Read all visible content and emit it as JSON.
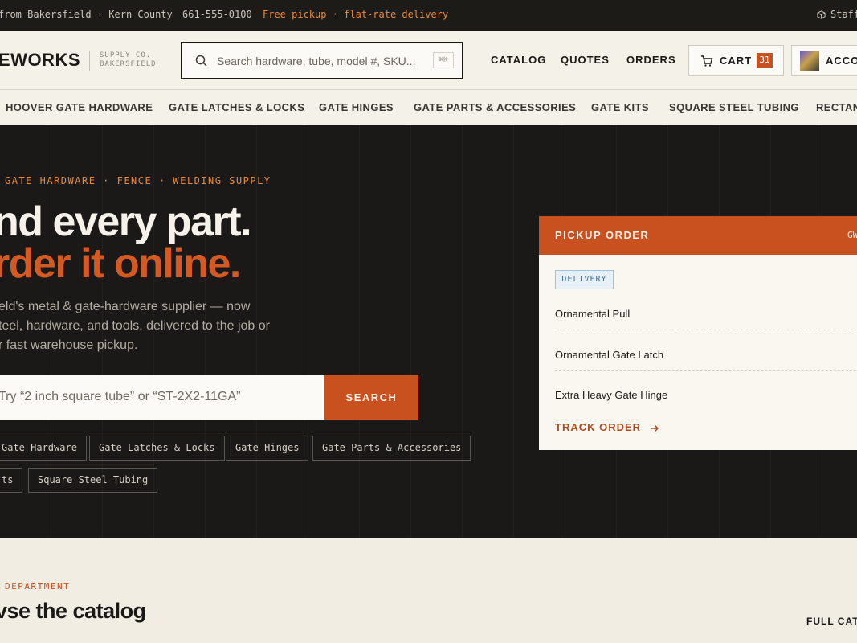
{
  "topbar": {
    "location": "from Bakersfield · Kern County",
    "phone": "661-555-0100",
    "promo": "Free pickup · flat-rate delivery",
    "staff": "Staff"
  },
  "header": {
    "logo": "EWORKS",
    "logo_sub_1": "SUPPLY CO.",
    "logo_sub_2": "BAKERSFIELD",
    "search_placeholder": "Search hardware, tube, model #, SKU...",
    "search_kbd": "⌘K",
    "nav": [
      "CATALOG",
      "QUOTES",
      "ORDERS"
    ],
    "cart_label": "CART",
    "cart_count": "31",
    "account_label": "ACCOUNT"
  },
  "categories": [
    "HOOVER GATE HARDWARE",
    "GATE LATCHES & LOCKS",
    "GATE HINGES",
    "GATE PARTS & ACCESSORIES",
    "GATE KITS",
    "SQUARE STEEL TUBING",
    "RECTANGULAR"
  ],
  "hero": {
    "kicker": "GATE HARDWARE · FENCE · WELDING SUPPLY",
    "headline_1": "nd every part.",
    "headline_2": "rder it online.",
    "lede_1": "eld's metal & gate-hardware supplier — now",
    "lede_2": "teel, hardware, and tools, delivered to the job or",
    "lede_3": "r fast warehouse pickup.",
    "search_placeholder": "Try “2 inch square tube” or “ST-2X2-11GA”",
    "search_button": "SEARCH",
    "chips_row1": [
      "Gate Hardware",
      "Gate Latches & Locks",
      "Gate Hinges",
      "Gate Parts & Accessories"
    ],
    "chips_row2": [
      "ts",
      "Square Steel Tubing"
    ]
  },
  "pickup_card": {
    "title": "PICKUP ORDER",
    "order_ref": "GW",
    "tag": "DELIVERY",
    "items": [
      "Ornamental Pull",
      "Ornamental Gate Latch",
      "Extra Heavy Gate Hinge"
    ],
    "track_label": "TRACK ORDER"
  },
  "department": {
    "kicker": "DEPARTMENT",
    "heading": "vse the catalog",
    "full_link": "FULL CATALOG"
  },
  "colors": {
    "accent": "#c8511f",
    "dark": "#1b1917",
    "cream": "#f4f1e9"
  }
}
